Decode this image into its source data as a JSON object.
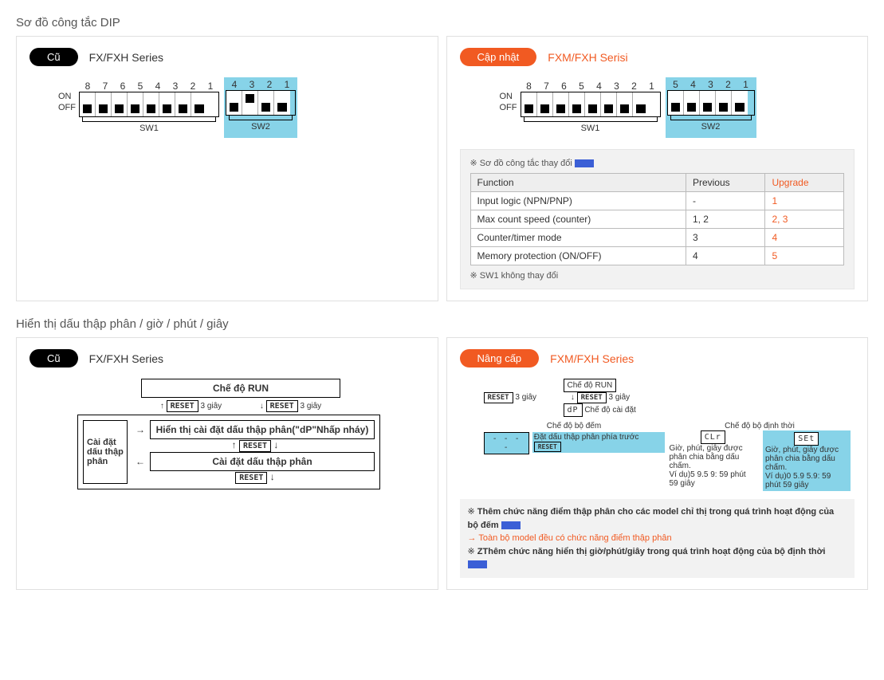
{
  "sections": {
    "dip": {
      "title": "Sơ đồ công tắc DIP"
    },
    "decimal": {
      "title": "Hiển thị dấu thập phân / giờ / phút / giây"
    }
  },
  "badges": {
    "old": "Cũ",
    "update": "Cập nhật",
    "upgrade": "Nâng cấp"
  },
  "series": {
    "fx": "FX/FXH Series",
    "fxm_vi": "FXM/FXH Serisi",
    "fxm_en": "FXM/FXH Series"
  },
  "dip": {
    "on": "ON",
    "off": "OFF",
    "sw1": "SW1",
    "sw2": "SW2",
    "old_sw1_nums": [
      "8",
      "7",
      "6",
      "5",
      "4",
      "3",
      "2",
      "1"
    ],
    "old_sw2_nums": [
      "4",
      "3",
      "2",
      "1"
    ],
    "new_sw2_nums": [
      "5",
      "4",
      "3",
      "2",
      "1"
    ],
    "note_change": "Sơ đồ công tắc thay đổi",
    "note_sw1": "SW1 không thay đổi",
    "table": {
      "h_func": "Function",
      "h_prev": "Previous",
      "h_upg": "Upgrade",
      "rows": [
        {
          "f": "Input logic (NPN/PNP)",
          "p": "-",
          "u": "1"
        },
        {
          "f": "Max count speed (counter)",
          "p": "1, 2",
          "u": "2, 3"
        },
        {
          "f": "Counter/timer mode",
          "p": "3",
          "u": "4"
        },
        {
          "f": "Memory protection (ON/OFF)",
          "p": "4",
          "u": "5"
        }
      ]
    }
  },
  "flow_old": {
    "run": "Chế độ RUN",
    "reset": "RESET",
    "sec3": "3 giây",
    "decset_title": "Hiển thị cài đặt dấu thập phân(\"dP\"Nhấp nháy)",
    "decset": "Cài đặt dấu thập phân",
    "side": "Cài đặt dấu thập phân"
  },
  "flow_new": {
    "run": "Chế độ RUN",
    "reset": "RESET",
    "sec3": "3 giây",
    "dp": "dP",
    "setmode": "Chế độ cài đặt",
    "counter_mode": "Chế độ bộ đếm",
    "timer_mode": "Chế độ bộ định thời",
    "dec_front": "Đặt dấu thập phân phía trước",
    "clr": "CLr",
    "set": "SEt",
    "desc_clr": "Giờ, phút, giây được phân chia bằng dấu chấm.",
    "ex_clr": "Ví dụ)5 9.5 9: 59 phút 59 giây",
    "desc_set": "Giờ, phút, giây được phân chia bằng dấu chấm.",
    "ex_set": "Ví dụ)0 5.9 5.9: 59 phút 59 giây"
  },
  "notes": {
    "n1a": "Thêm chức năng điểm thập phân cho các model chỉ thị trong quá trình hoạt động của bộ đếm",
    "n1b": "→ Toàn bộ model đều có chức năng điểm thập phân",
    "n2": "ZThêm chức năng hiển thị giờ/phút/giây trong quá trình hoạt động của bộ định thời"
  }
}
